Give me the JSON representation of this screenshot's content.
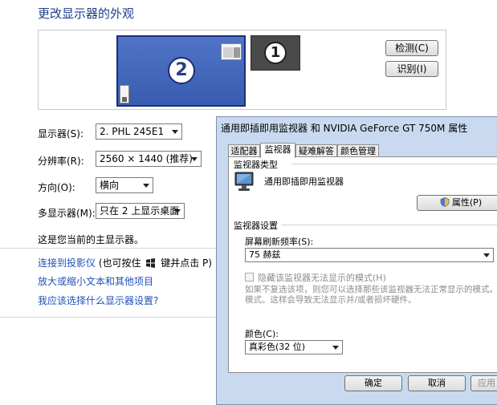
{
  "page": {
    "title": "更改显示器的外观",
    "identify_button": "检测(C)",
    "recognize_button": "识别(I)",
    "monitor2_number": "2",
    "monitor1_number": "1"
  },
  "settings": {
    "display_label": "显示器(S):",
    "display_value": "2. PHL 245E1",
    "resolution_label": "分辨率(R):",
    "resolution_value": "2560 × 1440 (推荐)",
    "orientation_label": "方向(O):",
    "orientation_value": "横向",
    "multi_label": "多显示器(M):",
    "multi_value": "只在 2 上显示桌面",
    "primary_note": "这是您当前的主显示器。"
  },
  "links": {
    "projector": "连接到投影仪",
    "projector_hint_pre": "(也可按住",
    "projector_hint_post": "键并点击 P)",
    "zoom_text": "放大或缩小文本和其他项目",
    "which_display": "我应该选择什么显示器设置?"
  },
  "dialog": {
    "title": "通用即插即用监视器 和 NVIDIA GeForce GT 750M   属性",
    "tabs": [
      "适配器",
      "监视器",
      "疑难解答",
      "颜色管理"
    ],
    "monitor_type_group": "监视器类型",
    "monitor_type_name": "通用即插即用监视器",
    "properties_button": "属性(P)",
    "monitor_settings_group": "监视器设置",
    "refresh_label": "屏幕刷新频率(S):",
    "refresh_value": "75 赫兹",
    "hide_modes_label": "隐藏该监视器无法显示的模式(H)",
    "hide_modes_desc_1": "如果不复选该项，则您可以选择那些该监视器无法正常显示的模式。",
    "hide_modes_desc_2": "模式。这样会导致无法显示并/或者损坏硬件。",
    "color_label": "颜色(C):",
    "color_value": "真彩色(32 位)",
    "ok_button": "确定",
    "cancel_button": "取消",
    "apply_button": "应用"
  },
  "colors": {
    "title_blue": "#1e3f8a",
    "link_blue": "#1e52b8",
    "monitor2_fill": "#4a6ec2",
    "monitor1_fill": "#4a4a4a",
    "dialog_frame": "#c9daf0"
  },
  "icons": [
    "windows-key-icon",
    "monitor-icon",
    "shield-properties-icon",
    "mini-window-icon"
  ]
}
